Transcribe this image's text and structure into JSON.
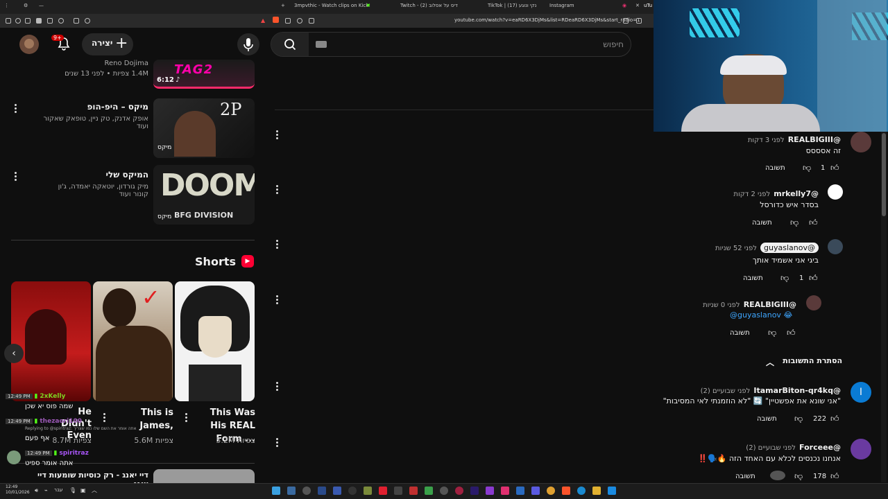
{
  "browser": {
    "tabs": [
      "3mpvthic - Watch clips on Kick",
      "Twitch - (2) דיס על אסלוב",
      "TikTok | (17) נקי ונוגע",
      "Instagram"
    ],
    "tab_badge": "uTu",
    "url": "youtube.com/watch?v=eaRD6X3DjMs&list=RDeaRD6X3DjMs&start_radio=1"
  },
  "header": {
    "create_label": "יצירה",
    "notification_count": "9+",
    "search_placeholder": "חיפוש"
  },
  "playlist": [
    {
      "channel": "Reno Dojima",
      "meta": "1.4M צפיות • לפני 13 שנים",
      "duration": "6:12"
    },
    {
      "title": "מיקס – היפ-הופ",
      "meta": "אופק אדנק, טק ניין, טופאק שאקור ועוד",
      "badge": "מיקס"
    },
    {
      "title": "המיקס שלי",
      "meta": "מיק גורדון, יוטאקה יאמדה, ג'ון קונור ועוד",
      "badge": "מיקס"
    }
  ],
  "thumbs": {
    "tupac_text": "2P",
    "doom_title": "DOOM",
    "doom_sub": "BFG DIVISION"
  },
  "shorts": {
    "heading": "Shorts",
    "items": [
      {
        "title": "He Didn't Even",
        "views": "8.7M צפיות"
      },
      {
        "title": "This is James,",
        "views": "5.6M צפיות"
      },
      {
        "title": "This Was His REAL Form ...",
        "views": "5.2M צפיות"
      }
    ]
  },
  "next_item": {
    "title": "דיי יאנג - רק כוסיות שומעות דיי יאנג"
  },
  "chat": [
    {
      "time": "12:49 PM",
      "user": "2xKelly",
      "text": "שמה פוס יא שכן",
      "color": "#7ed321"
    },
    {
      "time": "12:49 PM",
      "user": "thezaori100",
      "text": "אף פעם",
      "reply": "Replying to @spiritraz: אתה אומר את השם שלו כמו שצריך",
      "color": "#9b59b6"
    },
    {
      "time": "12:49 PM",
      "user": "spiritraz",
      "text": "אתה אומר ספיט",
      "color": "#a855f7"
    }
  ],
  "comments": [
    {
      "name": "@REALBIGIII",
      "time": "לפני 3 דקות",
      "text": "זה אסססס",
      "likes": "1",
      "reply": "תשובה"
    },
    {
      "name": "@mrkelly7",
      "time": "לפני 2 דקות",
      "text": "בסדר איש כדורסל",
      "likes": "",
      "reply": "תשובה"
    },
    {
      "name": "@guyaslanov",
      "time": "לפני 52 שניות",
      "text": "ביגי אני אשמיד אותך",
      "likes": "1",
      "reply": "תשובה"
    },
    {
      "name": "@REALBIGIII",
      "time": "לפני 0 שניות",
      "text": "@guyaslanov 😂",
      "likes": "",
      "reply": "תשובה"
    },
    {
      "name": "@ItamarBiton-qr4kq",
      "time": "לפני שבועיים (2)",
      "text": "\"אני שונא את אפשטיין\" 🔄 \"לא הוזמנתי לאי המסיבות\"",
      "likes": "222",
      "reply": "תשובה"
    },
    {
      "name": "@Forceee",
      "time": "לפני שבועיים (2)",
      "text": "אנחנו נכנסים לכלא עם האחד הזה 🔥🗣️‼️",
      "likes": "178",
      "reply": "תשובה"
    }
  ],
  "hide_replies": "הסתרת התשובות",
  "itamar_avatar_letter": "I",
  "taskbar": {
    "time": "12:49",
    "date": "10/01/2026",
    "lang": "עבר"
  },
  "colors": {
    "accent_red": "#ff0033",
    "link_blue": "#3ea6ff"
  }
}
